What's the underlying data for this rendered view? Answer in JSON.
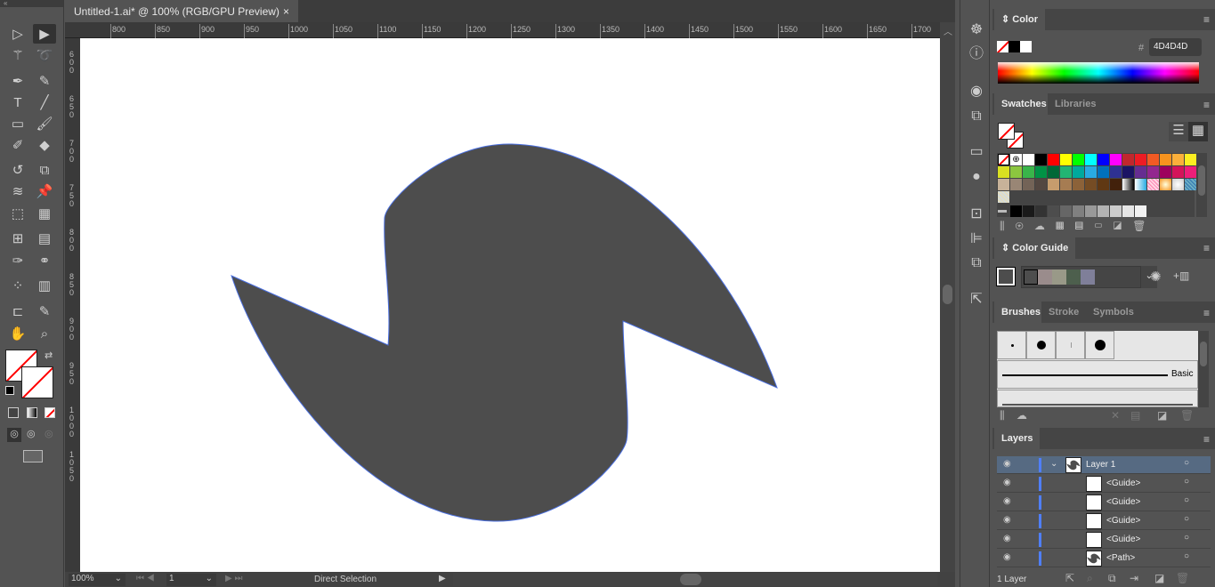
{
  "document": {
    "tab_title": "Untitled-1.ai* @ 100% (RGB/GPU Preview)",
    "close": "×"
  },
  "ruler": {
    "h_labels": [
      "800",
      "850",
      "900",
      "950",
      "1000",
      "1050",
      "1100",
      "1150",
      "1200",
      "1250",
      "1300",
      "1350",
      "1400",
      "1450",
      "1500",
      "1550",
      "1600",
      "1650",
      "1700"
    ],
    "v_labels": [
      "600",
      "650",
      "700",
      "750",
      "800",
      "850",
      "900",
      "950",
      "1000",
      "1050"
    ]
  },
  "tools": [
    "direct-selection",
    "selection",
    "magic-wand",
    "lasso",
    "pen",
    "curvature",
    "type",
    "line-segment",
    "rectangle",
    "paintbrush",
    "shaper",
    "eraser",
    "rotate",
    "scale",
    "width",
    "puppet-warp",
    "free-transform",
    "perspective-grid",
    "mesh",
    "gradient",
    "eyedropper",
    "blend",
    "symbol-sprayer",
    "column-graph",
    "artboard",
    "slice",
    "hand",
    "zoom"
  ],
  "shape": {
    "fill": "#4D4D4D",
    "stroke": "#4A6FE0"
  },
  "status": {
    "zoom": "100%",
    "artboard": "1",
    "tool": "Direct Selection"
  },
  "color_panel": {
    "title": "Color",
    "hex_label": "#",
    "hex": "4D4D4D"
  },
  "swatches_panel": {
    "tabs": [
      "Swatches",
      "Libraries"
    ],
    "rows": [
      [
        "none",
        "reg",
        "#FFFFFF",
        "#000000",
        "#FF0000",
        "#FFFF00",
        "#00FF00",
        "#00FFFF",
        "#0000FF",
        "#FF00FF",
        "#C1272D",
        "#ED1C24",
        "#F15A24",
        "#F7931E",
        "#FBB03B",
        "#FCEE21"
      ],
      [
        "#D9E021",
        "#8CC63F",
        "#39B54A",
        "#009245",
        "#006837",
        "#22B573",
        "#00A99D",
        "#29ABE2",
        "#0071BC",
        "#2E3192",
        "#1B1464",
        "#662D91",
        "#93278F",
        "#9E005D",
        "#D4145A",
        "#ED1E79"
      ],
      [
        "#C7B299",
        "#998675",
        "#736357",
        "#534741",
        "#C69C6D",
        "#A67C52",
        "#8C6239",
        "#754C24",
        "#603813",
        "#42210B",
        "grad1",
        "grad2",
        "grad3",
        "grad4",
        "grad5",
        "pattern"
      ],
      [
        "pattern2"
      ],
      [
        "folder",
        "#000000",
        "#1A1A1A",
        "#333333",
        "#4D4D4D",
        "#666666",
        "#808080",
        "#999999",
        "#B3B3B3",
        "#CCCCCC",
        "#E6E6E6",
        "#F2F2F2"
      ]
    ]
  },
  "color_guide": {
    "title": "Color Guide",
    "colors": [
      "#4D4D4D",
      "#9A8C8C",
      "#999988",
      "#4D5F4D",
      "#7F7F99"
    ]
  },
  "brushes_panel": {
    "tabs": [
      "Brushes",
      "Stroke",
      "Symbols"
    ],
    "basic_label": "Basic"
  },
  "layers_panel": {
    "title": "Layers",
    "count": "1 Layer",
    "rows": [
      {
        "name": "Layer 1",
        "type": "layer"
      },
      {
        "name": "<Guide>",
        "type": "guide"
      },
      {
        "name": "<Guide>",
        "type": "guide"
      },
      {
        "name": "<Guide>",
        "type": "guide"
      },
      {
        "name": "<Guide>",
        "type": "guide"
      },
      {
        "name": "<Path>",
        "type": "path"
      }
    ]
  }
}
